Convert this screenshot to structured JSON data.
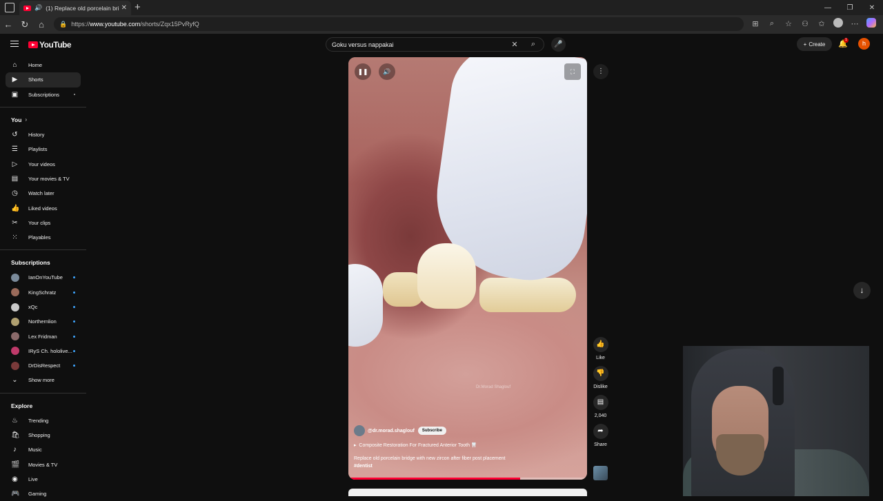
{
  "browser": {
    "tab_title": "(1) Replace old porcelain bri",
    "url_prefix": "https://",
    "url_host": "www.youtube.com",
    "url_path": "/shorts/Zqx15PvRyfQ"
  },
  "masthead": {
    "logo_text": "YouTube",
    "search_value": "Goku versus nappakai",
    "create_label": "Create",
    "notification_count": "1",
    "avatar_letter": "h"
  },
  "sidebar": {
    "main": [
      {
        "label": "Home",
        "icon": "home-icon"
      },
      {
        "label": "Shorts",
        "icon": "shorts-icon"
      },
      {
        "label": "Subscriptions",
        "icon": "subscriptions-icon"
      }
    ],
    "you_heading": "You",
    "you": [
      {
        "label": "History"
      },
      {
        "label": "Playlists"
      },
      {
        "label": "Your videos"
      },
      {
        "label": "Your movies & TV"
      },
      {
        "label": "Watch later"
      },
      {
        "label": "Liked videos"
      },
      {
        "label": "Your clips"
      },
      {
        "label": "Playables"
      }
    ],
    "subs_heading": "Subscriptions",
    "subscriptions": [
      {
        "label": "IanOnYouTube",
        "color": "#7a8a9a"
      },
      {
        "label": "KingSchratz",
        "color": "#9a6a5a"
      },
      {
        "label": "xQc",
        "color": "#c9c9c9"
      },
      {
        "label": "Northernlion",
        "color": "#b0a070"
      },
      {
        "label": "Lex Fridman",
        "color": "#8a6a6a"
      },
      {
        "label": "IRyS Ch. hololive...",
        "color": "#c03a6a"
      },
      {
        "label": "DrDisRespect",
        "color": "#7a3a3a"
      }
    ],
    "show_more": "Show more",
    "explore_heading": "Explore",
    "explore": [
      {
        "label": "Trending"
      },
      {
        "label": "Shopping"
      },
      {
        "label": "Music"
      },
      {
        "label": "Movies & TV"
      },
      {
        "label": "Live"
      },
      {
        "label": "Gaming"
      }
    ]
  },
  "short": {
    "watermark": "Dr.Morad Shaglouf",
    "channel": "@dr.morad.shaglouf",
    "subscribe_label": "Subscribe",
    "suggestion": "Composite Restoration For Fractured Anterior Tooth 🦷",
    "description": "Replace old porcelain bridge with new zircon after fiber post placement",
    "hashtag": "#dentist",
    "progress": 0.72
  },
  "actions": {
    "like": "Like",
    "dislike": "Dislike",
    "comments": "2,040",
    "share": "Share"
  }
}
